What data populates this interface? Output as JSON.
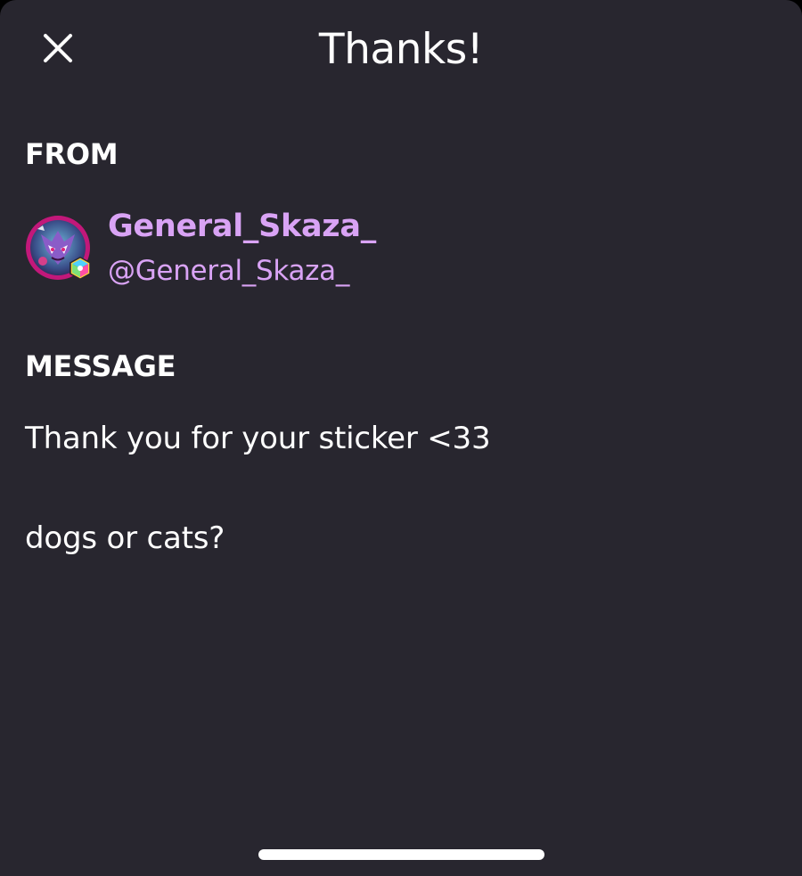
{
  "colors": {
    "background": "#28262f",
    "accent": "#d9a3f5",
    "text": "#ffffff"
  },
  "header": {
    "title": "Thanks!",
    "close_icon": "close-icon"
  },
  "from": {
    "label": "FROM",
    "display_name": "General_Skaza_",
    "handle": "@General_Skaza_",
    "avatar_icon": "avatar-icon",
    "badge_icon": "hexagon-badge-icon"
  },
  "message": {
    "label": "MESSAGE",
    "lines": [
      "Thank you for your sticker <33",
      "dogs or cats?"
    ]
  },
  "system": {
    "home_indicator_icon": "home-indicator"
  }
}
